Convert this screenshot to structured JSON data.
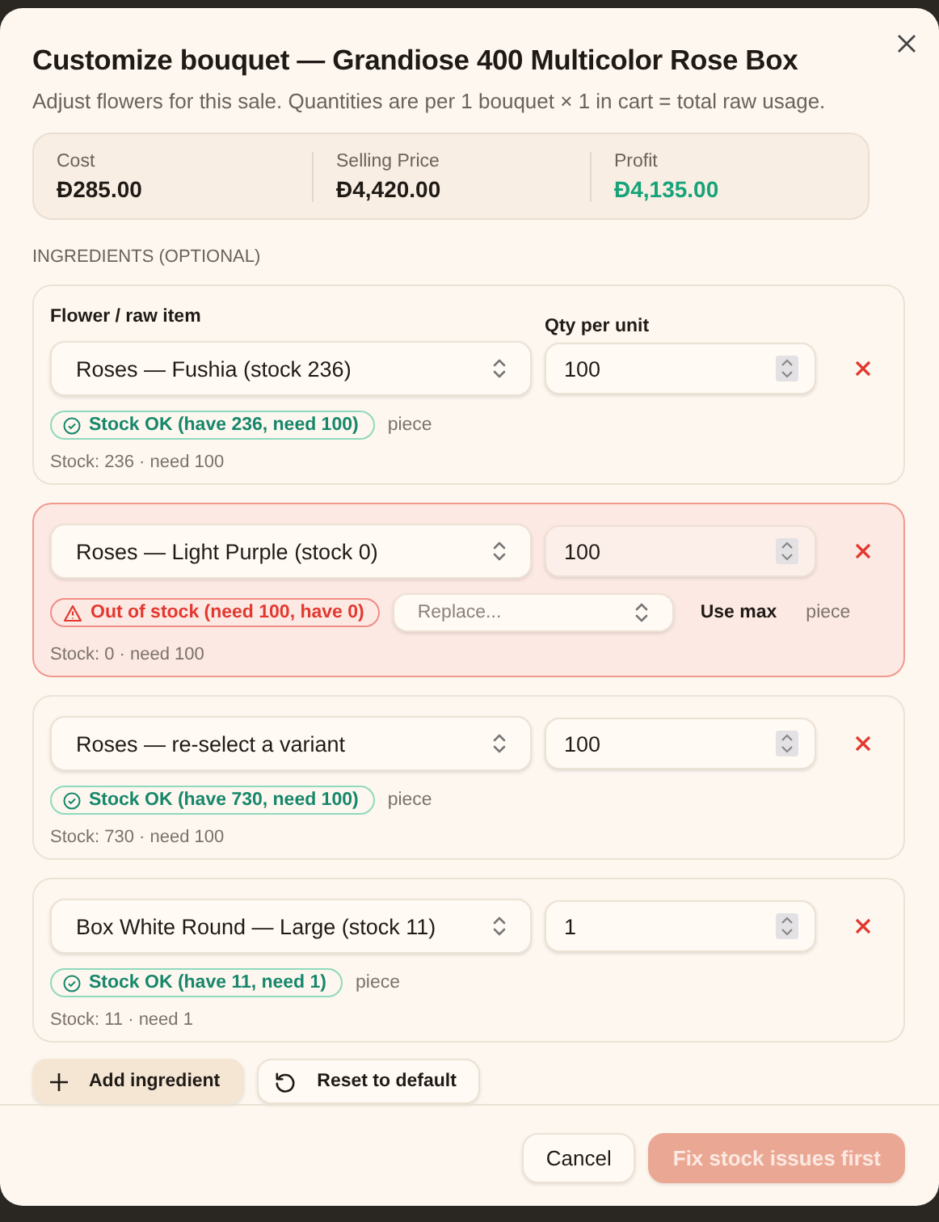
{
  "dialog": {
    "title": "Customize bouquet — Grandiose 400 Multicolor Rose Box",
    "subtitle": "Adjust flowers for this sale. Quantities are per 1 bouquet × 1 in cart = total raw usage."
  },
  "summary": [
    {
      "label": "Cost",
      "value": "Đ285.00",
      "kind": "plain"
    },
    {
      "label": "Selling Price",
      "value": "Đ4,420.00",
      "kind": "plain"
    },
    {
      "label": "Profit",
      "value": "Đ4,135.00",
      "kind": "positive"
    }
  ],
  "section_label": "INGREDIENTS (OPTIONAL)",
  "ingredients": [
    {
      "item_label": "Flower / raw item",
      "qty_label": "Qty per unit",
      "item": "Roses — Fushia (stock 236)",
      "qty": "100",
      "status": {
        "kind": "ok",
        "text": "Stock OK (have 236, need 100)"
      },
      "unit": "piece",
      "note": "Stock: 236 · need 100",
      "out_of_stock": false
    },
    {
      "item": "Roses — Light Purple (stock 0)",
      "qty": "100",
      "status": {
        "kind": "out",
        "text": "Out of stock (need 100, have 0)"
      },
      "replace": {
        "placeholder": "Replace..."
      },
      "use_max": "Use max",
      "unit": "piece",
      "note": "Stock: 0 · need 100",
      "out_of_stock": true
    },
    {
      "item": "Roses — re-select a variant",
      "qty": "100",
      "status": {
        "kind": "ok",
        "text": "Stock OK (have 730, need 100)"
      },
      "unit": "piece",
      "note": "Stock: 730 · need 100",
      "out_of_stock": false
    },
    {
      "item": "Box White Round — Large (stock 11)",
      "qty": "1",
      "status": {
        "kind": "ok",
        "text": "Stock OK (have 11, need 1)"
      },
      "unit": "piece",
      "note": "Stock: 11 · need 1",
      "out_of_stock": false
    }
  ],
  "actions": [
    {
      "label": "Add ingredient",
      "kind": "add"
    },
    {
      "label": "Reset to default",
      "kind": "reset"
    }
  ],
  "footer": [
    {
      "label": "Cancel",
      "kind": "secondary",
      "disabled": false
    },
    {
      "label": "Fix stock issues first",
      "kind": "primary",
      "disabled": true
    }
  ]
}
